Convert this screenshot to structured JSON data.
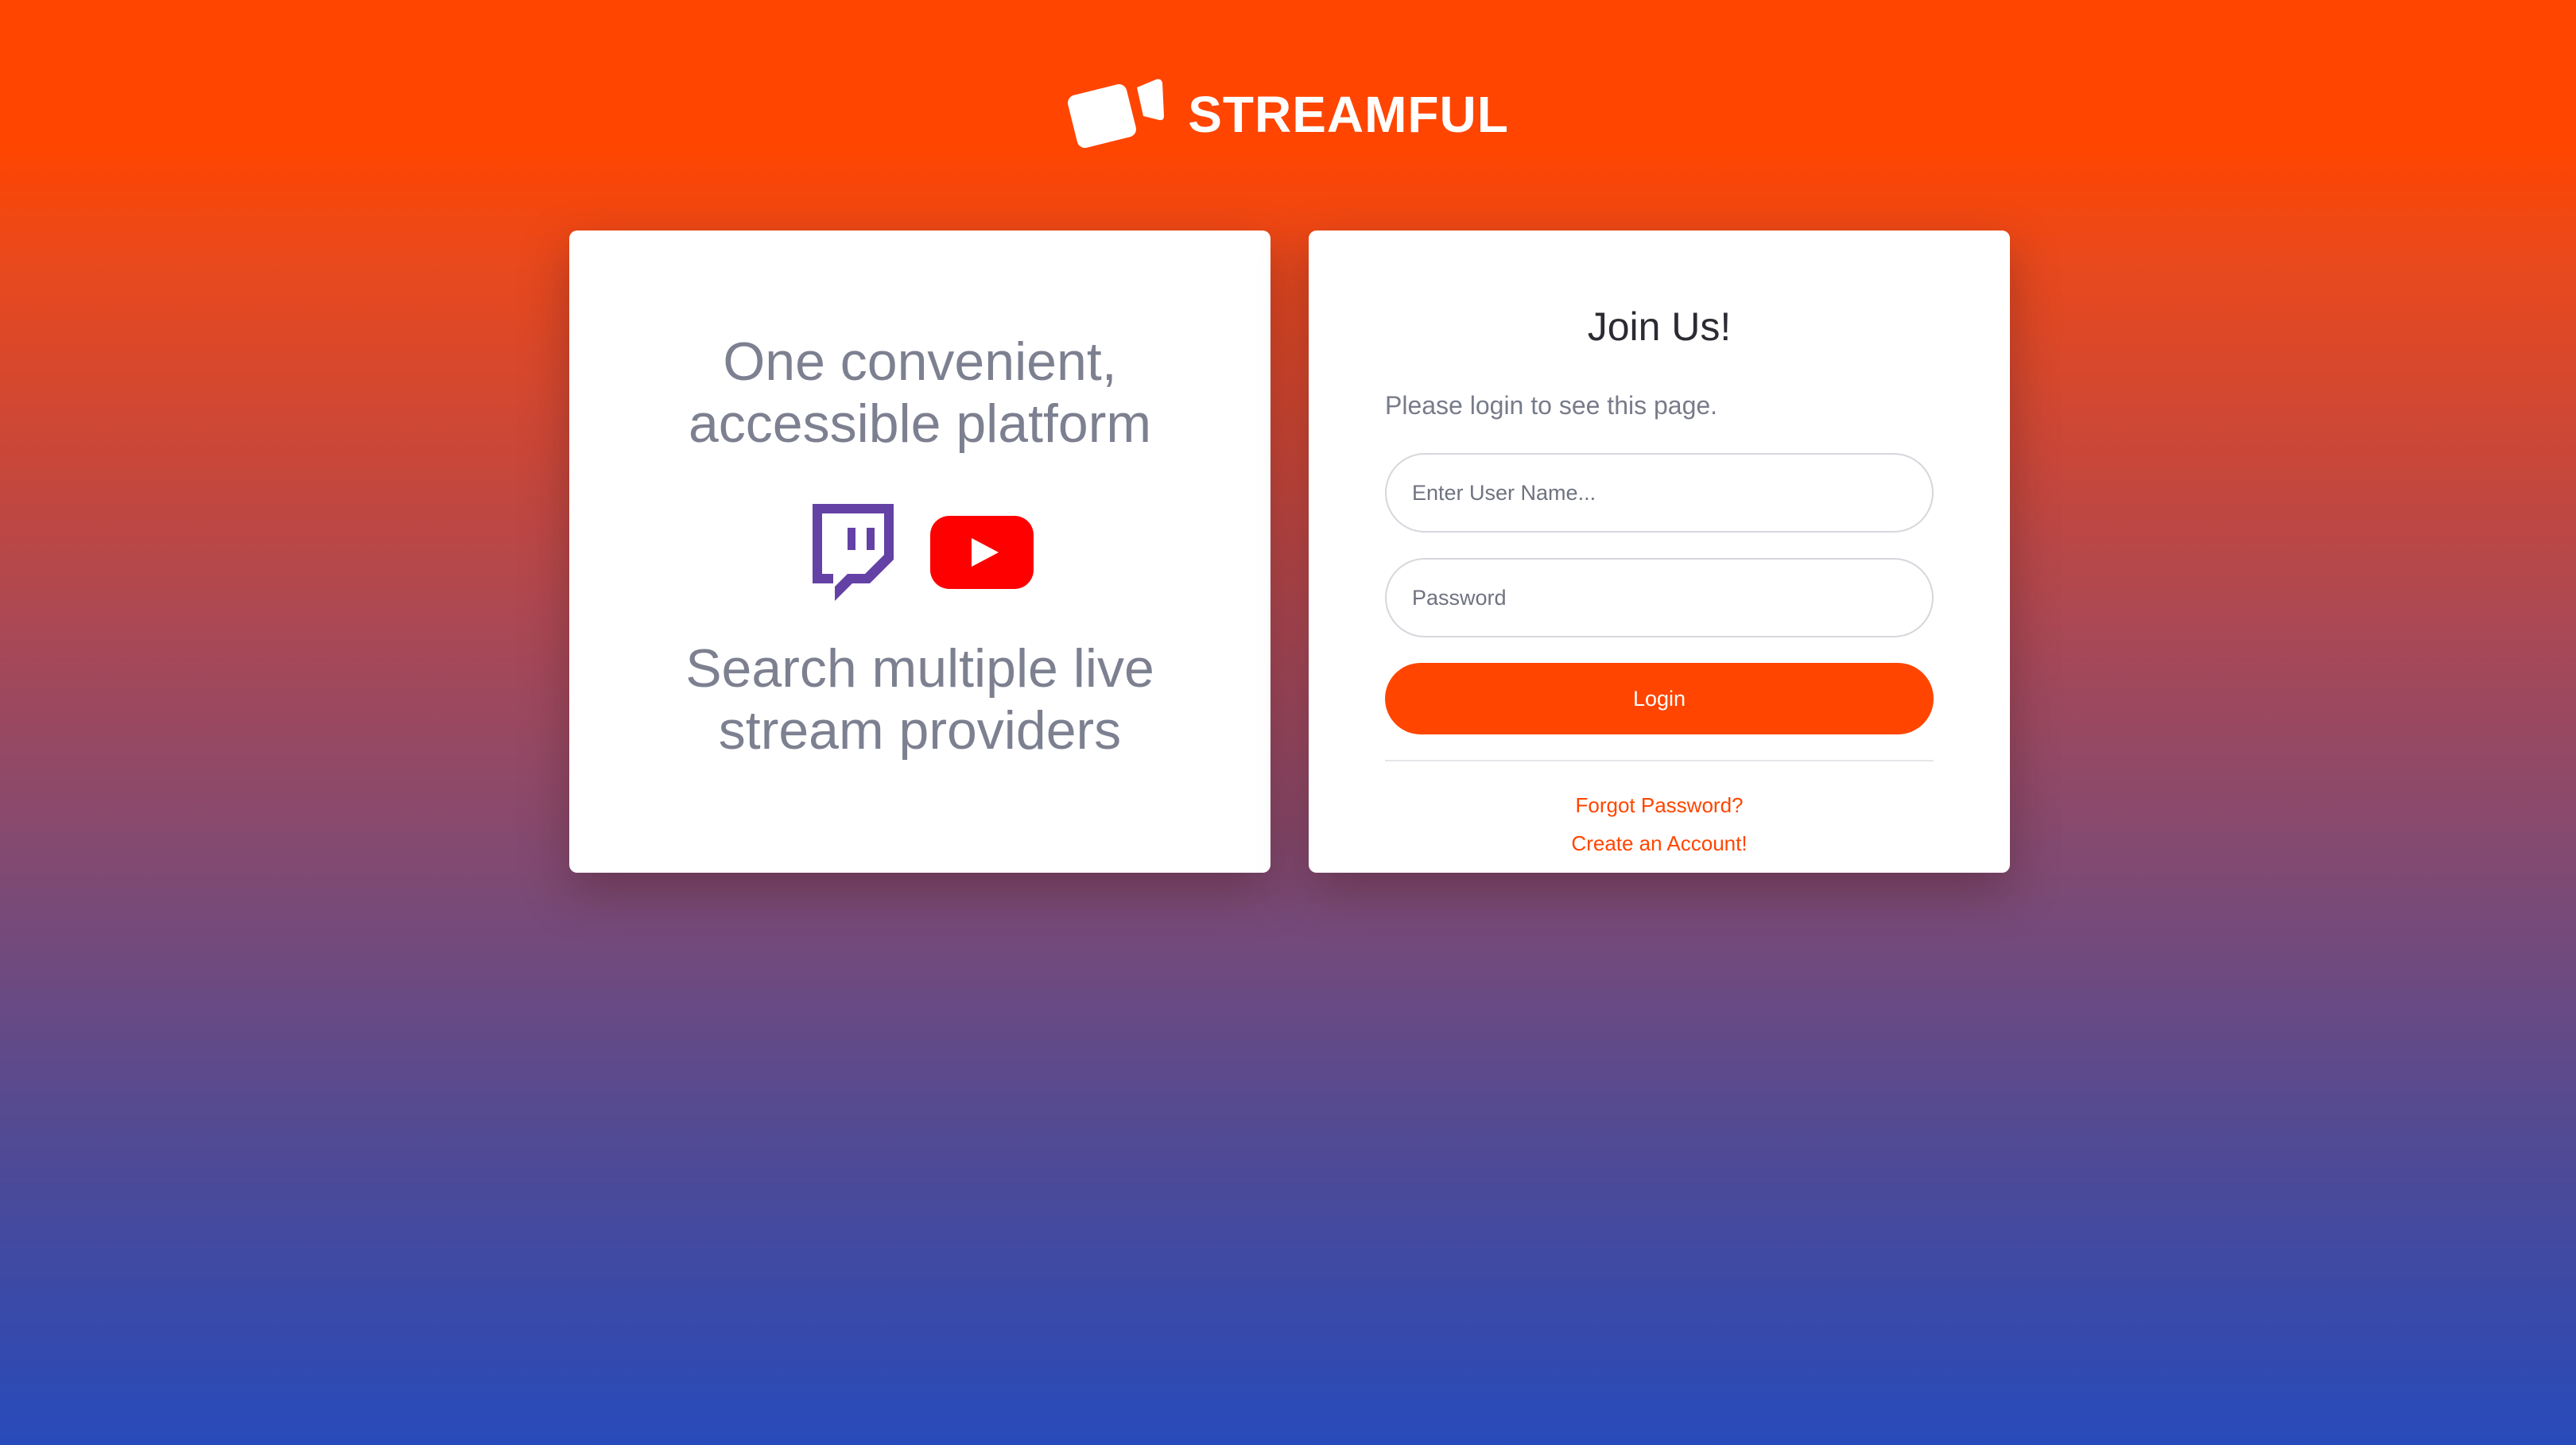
{
  "brand": {
    "name": "STREAMFUL",
    "logo_icon": "video-camera-icon"
  },
  "promo": {
    "headline_lines": [
      "One convenient,",
      "accessible platform"
    ],
    "tagline_lines": [
      "Search multiple live",
      "stream providers"
    ],
    "providers": [
      {
        "name": "twitch",
        "icon": "twitch-icon",
        "color": "#6441a5"
      },
      {
        "name": "youtube",
        "icon": "youtube-icon",
        "color": "#ff0000"
      }
    ]
  },
  "login": {
    "title": "Join Us!",
    "note": "Please login to see this page.",
    "username": {
      "value": "",
      "placeholder": "Enter User Name..."
    },
    "password": {
      "value": "",
      "placeholder": "Password"
    },
    "submit_label": "Login",
    "forgot_label": "Forgot Password?",
    "create_label": "Create an Account!"
  },
  "colors": {
    "accent": "#ff4500",
    "gradient_top": "#ff4500",
    "gradient_bottom": "#284bbb",
    "muted_text": "#7d8090"
  }
}
